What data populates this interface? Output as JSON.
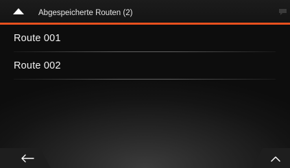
{
  "header": {
    "title": "Abgespeicherte Routen (2)",
    "accent_color": "#e8501e",
    "left_icon": "up-triangle-icon",
    "right_icon": "chat-bubble-icon"
  },
  "routes": [
    {
      "label": "Route 001"
    },
    {
      "label": "Route 002"
    }
  ],
  "footer": {
    "back_icon": "back-arrow-icon",
    "up_icon": "chevron-up-icon"
  }
}
